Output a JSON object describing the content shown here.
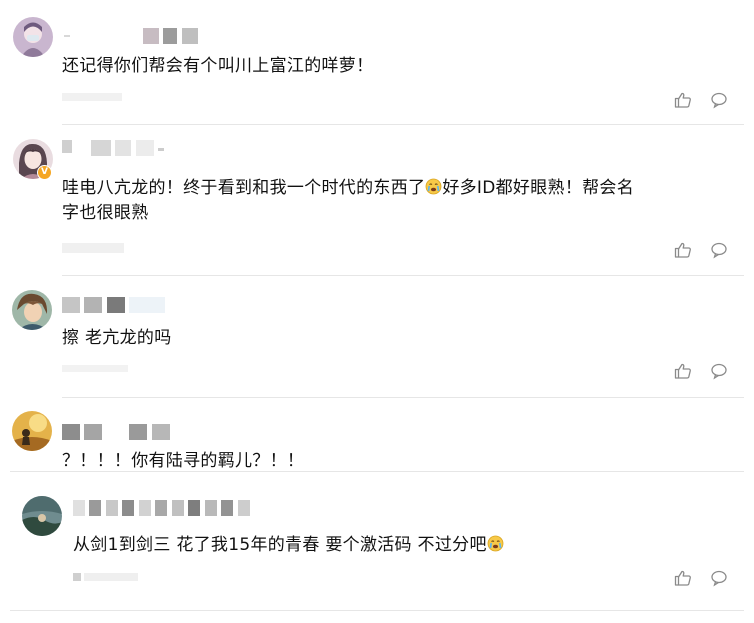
{
  "comments": [
    {
      "text": "还记得你们帮会有个叫川上富江的咩萝！",
      "like_icon": "thumbs-up-icon",
      "reply_icon": "comment-bubble-icon"
    },
    {
      "text_line1_a": "哇电八亢龙的！终于看到和我一个时代的东西了",
      "text_line1_b": "好多ID都好眼熟！帮会名",
      "text_line2": "字也很眼熟",
      "emoji": "crying-face-emoji",
      "badge": "V",
      "like_icon": "thumbs-up-icon",
      "reply_icon": "comment-bubble-icon"
    },
    {
      "text": "擦 老亢龙的吗",
      "like_icon": "thumbs-up-icon",
      "reply_icon": "comment-bubble-icon"
    },
    {
      "text": "？！！！你有陆寻的羁儿？！！"
    },
    {
      "text_a": "从剑1到剑三 花了我15年的青春 要个激活码 不过分吧",
      "emoji": "crying-face-emoji",
      "like_icon": "thumbs-up-icon",
      "reply_icon": "comment-bubble-icon"
    }
  ],
  "colors": {
    "divider": "#e6e6e6",
    "icon": "#8a8a8a",
    "badge": "#f5a623",
    "text": "#111111"
  }
}
